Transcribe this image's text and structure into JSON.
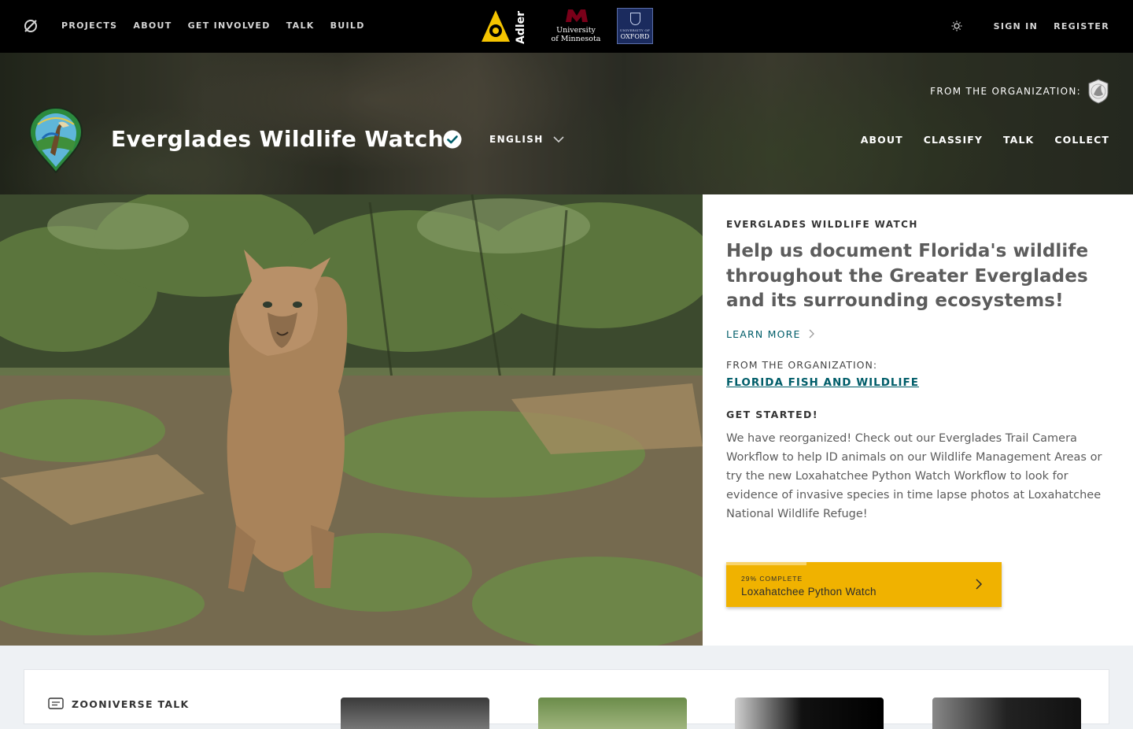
{
  "topnav": {
    "items": [
      "PROJECTS",
      "ABOUT",
      "GET INVOLVED",
      "TALK",
      "BUILD"
    ],
    "sign_in": "SIGN IN",
    "register": "REGISTER"
  },
  "partners": {
    "adler": "Adler",
    "umn_line1": "University",
    "umn_line2": "of Minnesota",
    "oxford_small": "UNIVERSITY OF",
    "oxford": "OXFORD"
  },
  "project": {
    "title": "Everglades Wildlife Watch",
    "language": "ENGLISH",
    "from_org_label": "FROM THE ORGANIZATION:",
    "nav": [
      "ABOUT",
      "CLASSIFY",
      "TALK",
      "COLLECT"
    ]
  },
  "intro": {
    "kicker": "EVERGLADES WILDLIFE WATCH",
    "description": "Help us document Florida's wildlife throughout the Greater Everglades and its surrounding ecosystems!",
    "learn_more": "LEARN MORE",
    "from_org_label": "FROM THE ORGANIZATION:",
    "org_name": "FLORIDA FISH AND WILDLIFE",
    "get_started": "GET STARTED!",
    "body": "We have reorganized! Check out our Everglades Trail Camera Workflow to help ID animals on our Wildlife Management Areas or try the new Loxahatchee Python Watch Workflow to look for evidence of invasive species in time lapse photos at Loxahatchee National Wildlife Refuge!"
  },
  "workflow": {
    "progress_label": "29% COMPLETE",
    "progress": 0.29,
    "name": "Loxahatchee Python Watch"
  },
  "talk": {
    "heading": "ZOONIVERSE TALK"
  },
  "colors": {
    "accent_teal": "#005d69",
    "workflow_yellow": "#f0b200",
    "topbar": "#000000"
  }
}
